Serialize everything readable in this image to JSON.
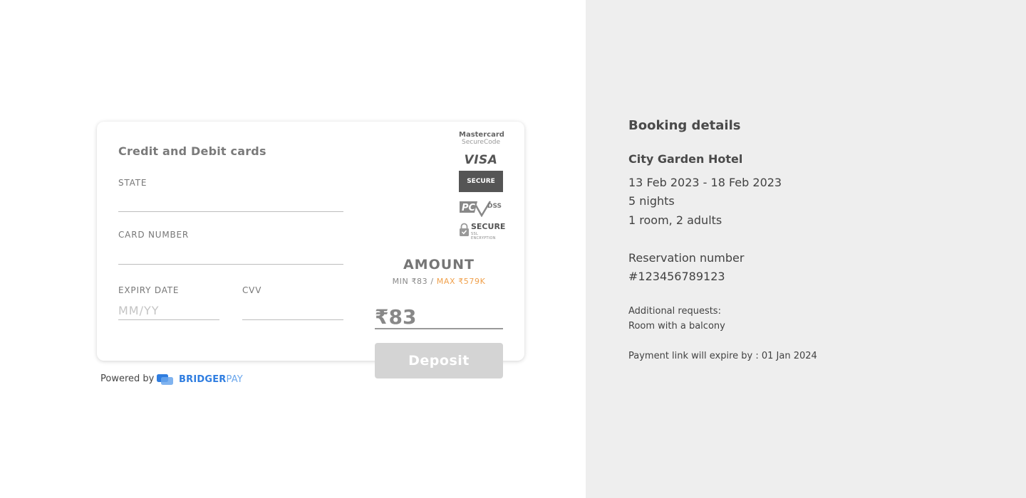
{
  "payment_form": {
    "title": "Credit and Debit cards",
    "state_label": "STATE",
    "state_value": "",
    "card_number_label": "CARD NUMBER",
    "card_number_value": "",
    "expiry_label": "EXPIRY DATE",
    "expiry_placeholder": "MM/YY",
    "cvv_label": "CVV",
    "cvv_value": ""
  },
  "badges": {
    "mastercard_line1": "Mastercard",
    "mastercard_line2": "SecureCode",
    "visa": "VISA",
    "visa_secure": "SECURE",
    "pci": "PCI",
    "pci_dss": "DSS",
    "ssl_title": "SECURE",
    "ssl_subtitle": "SSL ENCRYPTION"
  },
  "amount": {
    "title": "AMOUNT",
    "min_text": "MIN ₹83 /",
    "max_text": "MAX ₹579K",
    "value": "₹83",
    "deposit_label": "Deposit"
  },
  "footer": {
    "powered_by": "Powered by",
    "brand_bold": "BRIDGER",
    "brand_light": "PAY"
  },
  "booking": {
    "heading": "Booking details",
    "hotel": "City Garden Hotel",
    "dates": "13 Feb 2023 - 18 Feb 2023",
    "nights": "5 nights",
    "rooms_guests": "1 room, 2 adults",
    "reservation_label": "Reservation number",
    "reservation_number": "#123456789123",
    "additional_label": "Additional requests:",
    "additional_value": "Room with a balcony",
    "expiry_text": "Payment link will expire by : 01 Jan 2024"
  },
  "colors": {
    "right_pane_bg": "#eeeeee",
    "max_accent": "#f0a04b",
    "brand_blue": "#2f7de0",
    "deposit_disabled": "#d4d4d4"
  },
  "icons": [
    "mastercard-securecode-icon",
    "visa-secure-icon",
    "pci-dss-icon",
    "ssl-lock-icon",
    "bridgerpay-logo-icon"
  ]
}
